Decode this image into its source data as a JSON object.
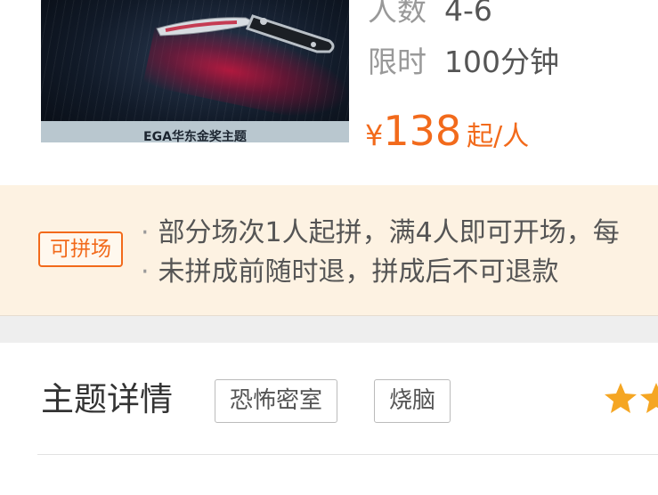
{
  "poster": {
    "caption": "EGA华东金奖主题",
    "icon": "knife-image"
  },
  "info": {
    "people_label": "人数",
    "people_value": "4-6",
    "time_label": "限时",
    "time_value": "100分钟",
    "price_symbol": "¥",
    "price_value": "138",
    "price_unit": "起/人"
  },
  "share": {
    "badge": "可拼场",
    "line1": "部分场次1人起拼，满4人即可开场，每",
    "line2": "未拼成前随时退，拼成后不可退款",
    "bullet": "·"
  },
  "theme": {
    "title": "主题详情",
    "tags": [
      "恐怖密室",
      "烧脑"
    ],
    "rating_icon": "star-icon"
  },
  "colors": {
    "accent": "#f26a1b",
    "banner_bg": "#fdf2e2",
    "star": "#f5a623"
  }
}
